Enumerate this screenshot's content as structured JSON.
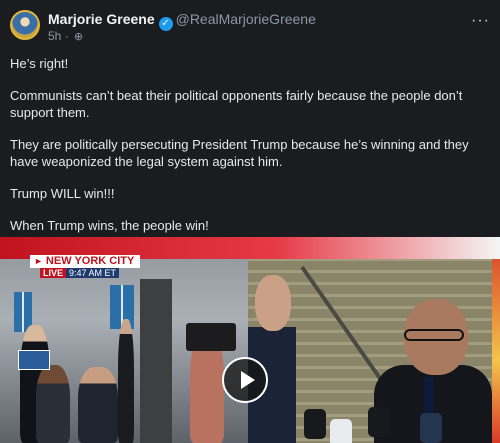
{
  "author": {
    "name": "Marjorie Greene",
    "handle": "@RealMarjorieGreene",
    "verified": "✓",
    "time": "5h",
    "separator": "·",
    "visibility_icon": "globe-icon"
  },
  "menu": {
    "more_label": "···"
  },
  "post": {
    "paragraphs": [
      "He’s right!",
      "Communists can’t beat their political opponents fairly because the people don’t support them.",
      "They are politically persecuting President Trump because he’s winning and they have weaponized the legal system against him.",
      "Trump WILL win!!!",
      "When Trump wins, the people win!"
    ]
  },
  "video": {
    "location_banner": "NEW YORK CITY",
    "live_label": "LIVE",
    "time_label": "9:47 AM ET",
    "play_icon": "play-icon"
  },
  "colors": {
    "accent_verified": "#1d9bf0",
    "live_red": "#c1121f",
    "background": "#1a1c20"
  }
}
